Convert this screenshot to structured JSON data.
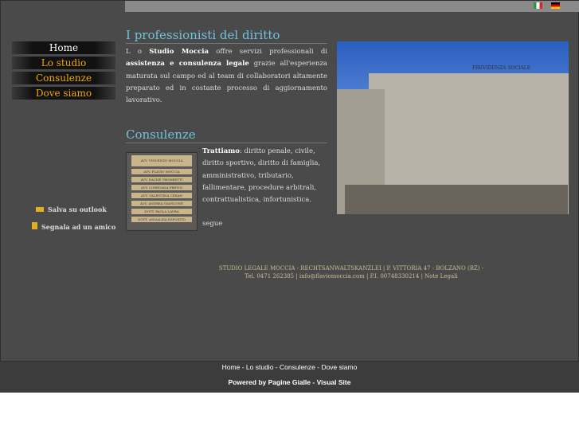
{
  "nav": [
    "Home",
    "Lo studio",
    "Consulenze",
    "Dove siamo"
  ],
  "side": {
    "save": "Salva su outlook",
    "share": "Segnala ad un amico"
  },
  "intro": {
    "title": "I professionisti del diritto",
    "p1": "L o ",
    "b1": "Studio Moccia",
    "p2": " offre servizi professionali di ",
    "b2": "assistenza e consulenza legale",
    "p3": " grazie all'esperienza maturata sul campo ed al team di collaboratori altamente preparato ed in costante processo di aggiornamento lavorativo."
  },
  "consulenze": {
    "title": "Consulenze",
    "b": "Trattiamo",
    "text": ": diritto penale, civile, diritto sportivo, diritto di famiglia, amministrativo, tributario, fallimentare, procedure arbitrali, contrattualistica, infortunistica.",
    "more": "segue"
  },
  "plaque": [
    "AVV. VINCENZO MOCCIA",
    "AVV. FLAVIO MOCCIA",
    "AVV. DACHE TROMBETTI",
    "AVV. LOREDANA PREVOI",
    "AVV. VALENTINA CERAN",
    "AVV. ANDREA GIANCONE",
    "DOTT. PAOLA LAVRA",
    "DOTT. ANNALISA ESPOSITO"
  ],
  "photo_sign": "PREVIDENZA SOCIALE",
  "address": {
    "line1": "STUDIO LEGALE MOCCIA - RECHTSANWALTSKANZLEI | P. VITTORIA 47 - BOLZANO (BZ) -",
    "tel": "Tel. 0471 262385",
    "email": "info@flaviomoccia.com",
    "piva": " | P.I. 00748330214 | ",
    "legal": "Note Legali"
  },
  "footer": {
    "links": [
      "Home",
      "Lo studio",
      "Consulenze",
      "Dove siamo"
    ],
    "powered": "Powered by",
    "pg": "Pagine Gialle",
    "vs": "Visual Site"
  }
}
